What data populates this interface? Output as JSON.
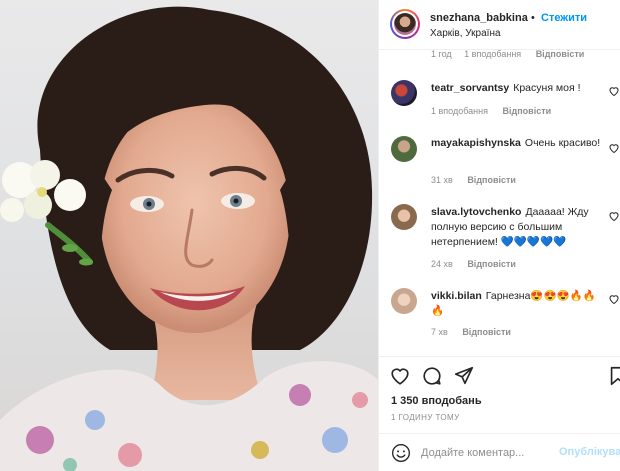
{
  "post": {
    "owner": {
      "username": "snezhana_babkina",
      "follow_label": "Стежити",
      "location": "Харків, Україна"
    },
    "comments": [
      {
        "username": "",
        "text": "",
        "time": "1 год",
        "likes": "1 вподобання",
        "reply_label": "Відповісти"
      },
      {
        "username": "teatr_sorvantsy",
        "text": "Красуня моя !",
        "time": "",
        "likes": "1 вподобання",
        "reply_label": "Відповісти"
      },
      {
        "username": "mayakapishynska",
        "text": "Очень красиво!",
        "time": "31 хв",
        "likes": "",
        "reply_label": "Відповісти"
      },
      {
        "username": "slava.lytovchenko",
        "text": "Дааааа! Жду полную версию с большим нетерпением! 💙💙💙💙💙",
        "time": "24 хв",
        "likes": "",
        "reply_label": "Відповісти"
      },
      {
        "username": "vikki.bilan",
        "text": "Гарнезна😍😍😍🔥🔥🔥",
        "time": "7 хв",
        "likes": "",
        "reply_label": "Відповісти"
      }
    ],
    "likes_count": "1 350 вподобань",
    "posted_time": "1 ГОДИНУ ТОМУ",
    "add_comment": {
      "placeholder": "Додайте коментар...",
      "publish_label": "Опублікувати"
    },
    "icons": [
      "heart-icon",
      "comment-icon",
      "share-icon",
      "bookmark-icon",
      "emoji-icon"
    ],
    "colors": {
      "link_blue": "#0095f6",
      "meta_gray": "#8e8e8e",
      "publish_disabled": "#b2dffc"
    }
  }
}
